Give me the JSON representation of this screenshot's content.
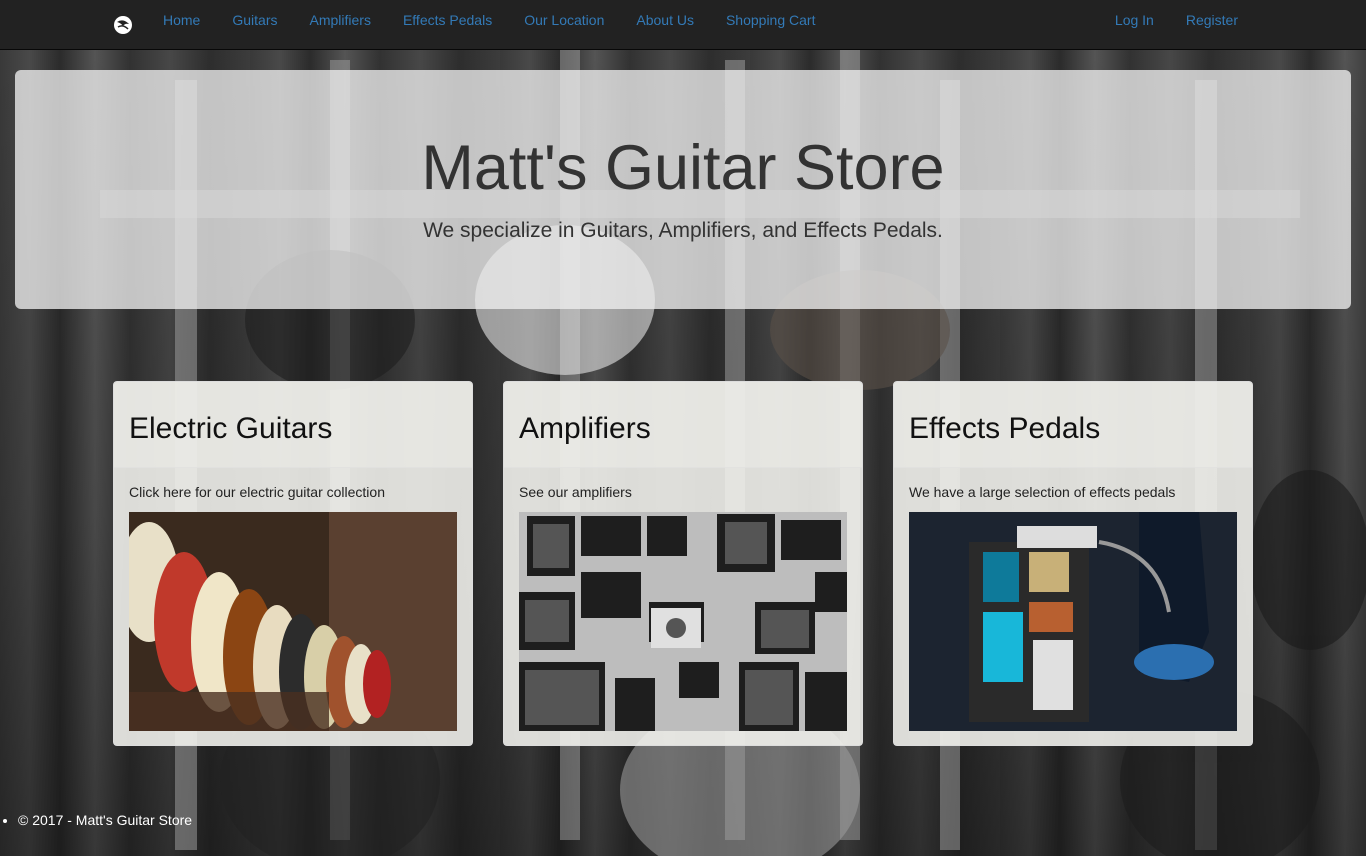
{
  "nav": {
    "brand_icon": "guitar-logo-icon",
    "links": [
      "Home",
      "Guitars",
      "Amplifiers",
      "Effects Pedals",
      "Our Location",
      "About Us",
      "Shopping Cart"
    ],
    "right_links": [
      "Log In",
      "Register"
    ],
    "link_color": "#337ab7"
  },
  "hero": {
    "title": "Matt's Guitar Store",
    "subtitle": "We specialize in Guitars, Amplifiers, and Effects Pedals."
  },
  "cards": [
    {
      "title": "Electric Guitars",
      "text": "Click here for our electric guitar collection"
    },
    {
      "title": "Amplifiers",
      "text": "See our amplifiers"
    },
    {
      "title": "Effects Pedals",
      "text": "We have a large selection of effects pedals"
    }
  ],
  "footer": {
    "text": "© 2017 - Matt's Guitar Store"
  }
}
